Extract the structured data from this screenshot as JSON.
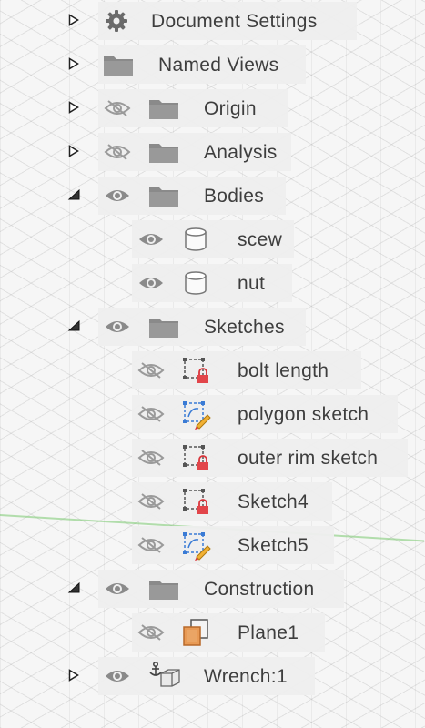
{
  "browser_tree": {
    "items": [
      {
        "label": "Document Settings",
        "expanded": false,
        "visible": null,
        "icon": "gear-icon"
      },
      {
        "label": "Named Views",
        "expanded": false,
        "visible": null,
        "icon": "folder-icon"
      },
      {
        "label": "Origin",
        "expanded": false,
        "visible": false,
        "icon": "folder-icon"
      },
      {
        "label": "Analysis",
        "expanded": false,
        "visible": false,
        "icon": "folder-icon"
      },
      {
        "label": "Bodies",
        "expanded": true,
        "visible": true,
        "icon": "folder-icon",
        "children": [
          {
            "label": "scew",
            "visible": true,
            "icon": "body-icon"
          },
          {
            "label": "nut",
            "visible": true,
            "icon": "body-icon"
          }
        ]
      },
      {
        "label": "Sketches",
        "expanded": true,
        "visible": true,
        "icon": "folder-icon",
        "children": [
          {
            "label": "bolt length",
            "visible": false,
            "icon": "sketch-locked-icon"
          },
          {
            "label": "polygon sketch",
            "visible": false,
            "icon": "sketch-edit-icon"
          },
          {
            "label": "outer rim sketch",
            "visible": false,
            "icon": "sketch-locked-icon"
          },
          {
            "label": "Sketch4",
            "visible": false,
            "icon": "sketch-locked-icon"
          },
          {
            "label": "Sketch5",
            "visible": false,
            "icon": "sketch-edit-icon"
          }
        ]
      },
      {
        "label": "Construction",
        "expanded": true,
        "visible": true,
        "icon": "folder-icon",
        "children": [
          {
            "label": "Plane1",
            "visible": false,
            "icon": "plane-icon"
          }
        ]
      },
      {
        "label": "Wrench:1",
        "expanded": false,
        "visible": true,
        "icon": "component-icon"
      }
    ]
  }
}
